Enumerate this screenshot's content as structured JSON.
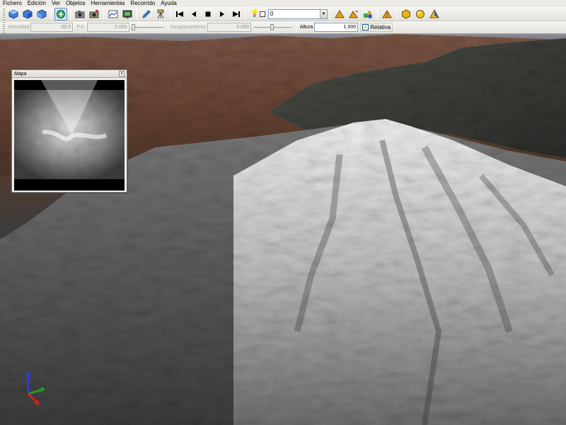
{
  "menubar": {
    "items": [
      "Fichero",
      "Edición",
      "Ver",
      "Objetos",
      "Herramientas",
      "Recorrido",
      "Ayuda"
    ]
  },
  "toolbar1": {
    "light_combo": {
      "value": "0"
    },
    "icons": [
      "cube-view-icon",
      "cube-side-icon",
      "cube-top-icon",
      "navigate-icon",
      "camera-icon",
      "camera-save-icon",
      "profile-icon",
      "screen-icon",
      "pencil-icon",
      "tripod-icon",
      "skip-back-icon",
      "play-reverse-icon",
      "stop-icon",
      "play-icon",
      "skip-forward-icon",
      "bulb-icon",
      "object-add-icon",
      "object-move-icon",
      "object-group-icon",
      "object-cone-icon",
      "shape-hex-icon",
      "shape-sphere-icon",
      "shape-pyramid-icon"
    ]
  },
  "toolbar2": {
    "velocidad_label": "Velocidad",
    "velocidad_value": "60.0",
    "pk_label": "P.K.",
    "pk_value": "0.000",
    "desplazamiento_label": "Desplazamiento",
    "desplazamiento_value": "0.000",
    "altura_label": "Altura",
    "altura_value": "1.000",
    "relativa_label": "Relativa",
    "relativa_checked": true
  },
  "map_window": {
    "title": "Mapa",
    "close_glyph": "x"
  },
  "colors": {
    "accent": "#6b8fc9",
    "terrain_light": "#e9e9e9",
    "terrain_dark": "#3a3a3a",
    "axis_x": "#d62020",
    "axis_y": "#21a121",
    "axis_z": "#2a3fd6"
  }
}
